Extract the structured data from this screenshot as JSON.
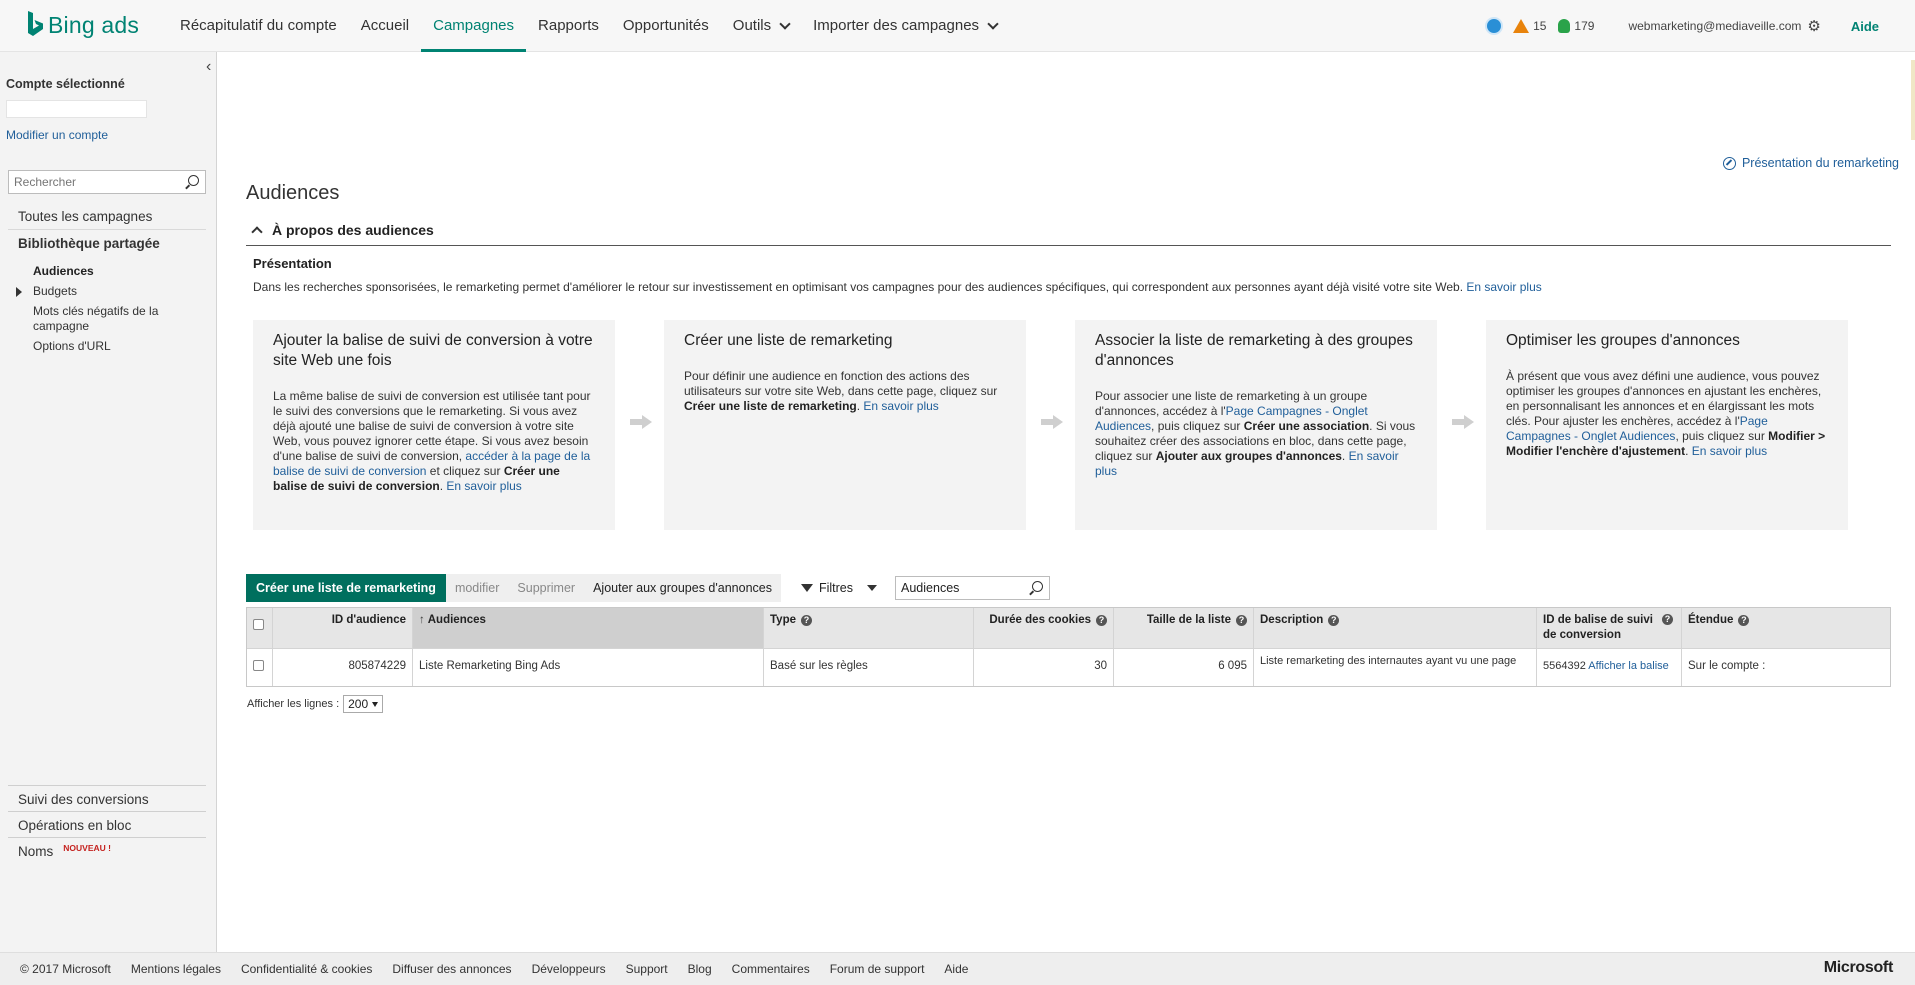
{
  "brand": {
    "name": "Bing ads",
    "color": "#008373"
  },
  "nav": {
    "items": [
      {
        "label": "Récapitulatif du compte",
        "active": false
      },
      {
        "label": "Accueil",
        "active": false
      },
      {
        "label": "Campagnes",
        "active": true
      },
      {
        "label": "Rapports",
        "active": false
      },
      {
        "label": "Opportunités",
        "active": false
      },
      {
        "label": "Outils",
        "active": false
      },
      {
        "label": "Importer des campagnes",
        "active": false
      }
    ]
  },
  "top_right": {
    "warnings_count": "15",
    "opportunities_count": "179",
    "account_email": "webmarketing@mediaveille.com",
    "help_label": "Aide"
  },
  "sidebar": {
    "selected_account_label": "Compte sélectionné",
    "modify_account": "Modifier un compte",
    "search_placeholder": "Rechercher",
    "all_campaigns": "Toutes les campagnes",
    "shared_library": "Bibliothèque partagée",
    "sub_items": [
      "Audiences",
      "Budgets",
      "Mots clés négatifs de la campagne",
      "Options d'URL"
    ],
    "bottom_items": [
      "Suivi des conversions",
      "Opérations en bloc",
      "Noms"
    ],
    "new_badge": "NOUVEAU !"
  },
  "main": {
    "remarketing_link": "Présentation du remarketing",
    "title": "Audiences",
    "section": "À propos des audiences",
    "presentation_title": "Présentation",
    "presentation_text": "Dans les recherches sponsorisées, le remarketing permet d'améliorer le retour sur investissement en optimisant vos campagnes pour des audiences spécifiques, qui correspondent aux personnes ayant déjà visité votre site Web.",
    "learn_more": "En savoir plus",
    "steps": [
      {
        "title": "Ajouter la balise de suivi de conversion à votre site Web une fois",
        "t1": "La même balise de suivi de conversion est utilisée tant pour le suivi des conversions que le remarketing. Si vous avez déjà ajouté une balise de suivi de conversion à votre site Web, vous pouvez ignorer cette étape. Si vous avez besoin d'une balise de suivi de conversion,",
        "link1": "accéder à la page de la balise de suivi de conversion",
        "t2": "et cliquez sur",
        "bold1": "Créer une balise de suivi de conversion",
        "t3": ".",
        "more": "En savoir plus"
      },
      {
        "title": "Créer une liste de remarketing",
        "t1": "Pour définir une audience en fonction des actions des utilisateurs sur votre site Web, dans cette page, cliquez sur",
        "bold1": "Créer une liste de remarketing",
        "t2": ".",
        "more": "En savoir plus"
      },
      {
        "title": "Associer la liste de remarketing à des groupes d'annonces",
        "t1": "Pour associer une liste de remarketing à un groupe d'annonces, accédez à l'",
        "link1": "Page Campagnes - Onglet Audiences",
        "t2": ", puis cliquez sur",
        "bold1": "Créer une association",
        "t3": ". Si vous souhaitez créer des associations en bloc, dans cette page, cliquez sur",
        "bold2": "Ajouter aux groupes d'annonces",
        "t4": ".",
        "more": "En savoir plus"
      },
      {
        "title": "Optimiser les groupes d'annonces",
        "t1": "À présent que vous avez défini une audience, vous pouvez optimiser les groupes d'annonces en ajustant les enchères, en personnalisant les annonces et en élargissant les mots clés. Pour ajuster les enchères, accédez à l'",
        "link1": "Page Campagnes - Onglet Audiences",
        "t2": ", puis cliquez sur",
        "bold1": "Modifier > Modifier l'enchère d'ajustement",
        "t3": ".",
        "more": "En savoir plus"
      }
    ],
    "toolbar": {
      "create": "Créer une liste de remarketing",
      "modify": "modifier",
      "delete": "Supprimer",
      "add_groups": "Ajouter aux groupes d'annonces",
      "filters": "Filtres",
      "search_value": "Audiences"
    },
    "table": {
      "headers": [
        "ID d'audience",
        "Audiences",
        "Type",
        "Durée des cookies",
        "Taille de la liste",
        "Description",
        "ID de balise de suivi de conversion",
        "Étendue"
      ],
      "rows": [
        {
          "id": "805874229",
          "name": "Liste Remarketing Bing Ads",
          "type": "Basé sur les règles",
          "cookies": "30",
          "size": "6 095",
          "description": "Liste remarketing des internautes ayant vu une page",
          "tag_id": "5564392",
          "tag_link": "Afficher la balise",
          "scope": "Sur le compte :"
        }
      ]
    },
    "rows_label": "Afficher les lignes :",
    "rows_value": "200"
  },
  "footer": {
    "items": [
      "© 2017 Microsoft",
      "Mentions légales",
      "Confidentialité & cookies",
      "Diffuser des annonces",
      "Développeurs",
      "Support",
      "Blog",
      "Commentaires",
      "Forum de support",
      "Aide"
    ],
    "logo": "Microsoft"
  }
}
